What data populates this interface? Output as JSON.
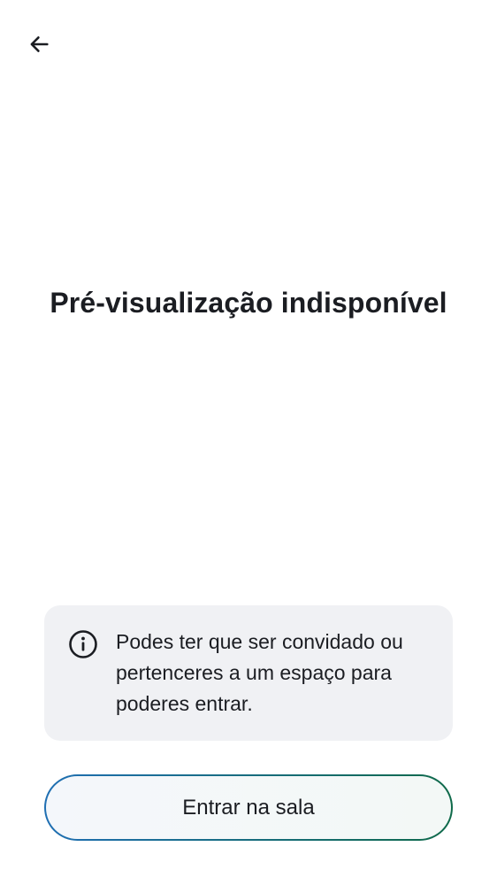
{
  "header": {
    "back_icon": "arrow-left-icon"
  },
  "main": {
    "title": "Pré-visualização indisponível"
  },
  "notice": {
    "icon": "info-icon",
    "text": "Podes ter que ser convidado ou pertenceres a um espaço para poderes entrar."
  },
  "actions": {
    "join_label": "Entrar na sala"
  },
  "colors": {
    "text": "#1b1d22",
    "card_bg": "#f0f1f4",
    "button_border_start": "#1f6fb3",
    "button_border_end": "#0f6a4a"
  }
}
